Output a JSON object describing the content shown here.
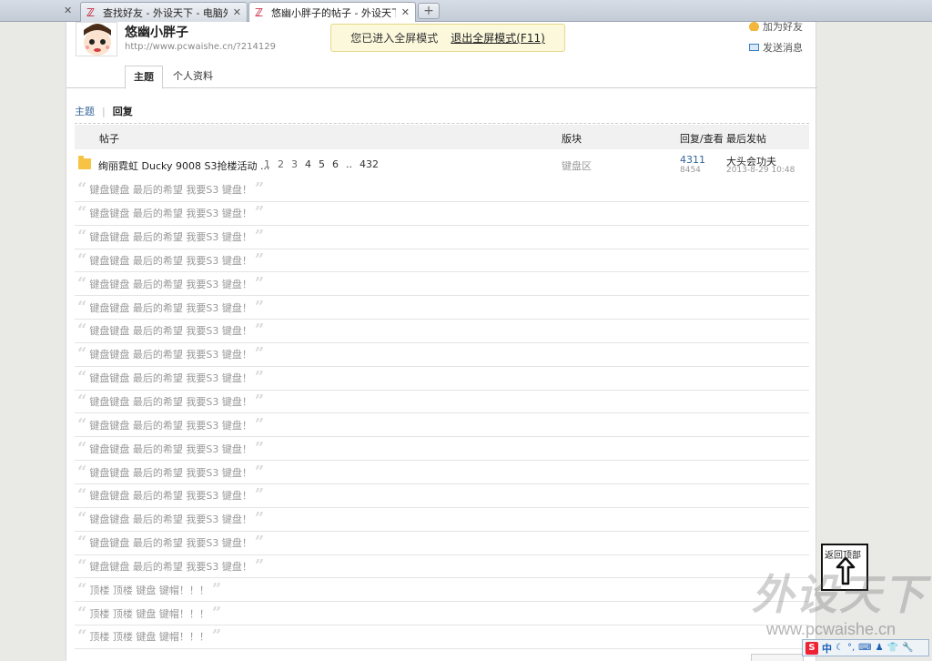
{
  "browser": {
    "tabs": [
      {
        "title": "",
        "active": false
      },
      {
        "title": "查找好友 - 外设天下 - 电脑外",
        "active": false
      },
      {
        "title": "悠幽小胖子的帖子 - 外设天下",
        "active": true
      }
    ],
    "close_glyph": "✕",
    "new_tab_glyph": "+"
  },
  "profile": {
    "username": "悠幽小胖子",
    "url": "http://www.pcwaishe.cn/?214129",
    "add_friend": "加为好友",
    "send_message": "发送消息",
    "tabs": [
      "主题",
      "个人资料"
    ]
  },
  "fullscreen": {
    "notice": "您已进入全屏模式",
    "exit_label": "退出全屏模式(F11)"
  },
  "subnav": {
    "topics": "主题",
    "separator": "|",
    "replies": "回复"
  },
  "table": {
    "headers": {
      "thread": "帖子",
      "board": "版块",
      "stats": "回复/查看",
      "last_post": "最后发帖"
    },
    "thread": {
      "title": "绚丽霓虹 Ducky 9008 S3抢楼活动 ...",
      "pages": [
        "1",
        "2",
        "3",
        "4",
        "5",
        "6",
        "..",
        "432"
      ],
      "board": "键盘区",
      "replies": "4311",
      "views": "8454",
      "last_user": "大头会功夫",
      "last_time": "2013-8-29 10:48"
    },
    "reply_snippets": [
      "键盘键盘 最后的希望 我要S3 键盘！",
      "键盘键盘 最后的希望 我要S3 键盘！",
      "键盘键盘 最后的希望 我要S3 键盘！",
      "键盘键盘 最后的希望 我要S3 键盘！",
      "键盘键盘 最后的希望 我要S3 键盘！",
      "键盘键盘 最后的希望 我要S3 键盘！",
      "键盘键盘 最后的希望 我要S3 键盘！",
      "键盘键盘 最后的希望 我要S3 键盘！",
      "键盘键盘 最后的希望 我要S3 键盘！",
      "键盘键盘 最后的希望 我要S3 键盘！",
      "键盘键盘 最后的希望 我要S3 键盘！",
      "键盘键盘 最后的希望 我要S3 键盘！",
      "键盘键盘 最后的希望 我要S3 键盘！",
      "键盘键盘 最后的希望 我要S3 键盘！",
      "键盘键盘 最后的希望 我要S3 键盘！",
      "键盘键盘 最后的希望 我要S3 键盘！",
      "键盘键盘 最后的希望 我要S3 键盘！",
      "顶楼 顶楼 键盘 键帽！！！",
      "顶楼 顶楼 键盘 键帽！！！",
      "顶楼 顶楼 键盘 键帽！！！"
    ],
    "quote_open": "“",
    "quote_close": "”"
  },
  "back_to_top": {
    "label": "返回顶部"
  },
  "watermark": {
    "logo": "外设天下",
    "url": "www.pcwaishe.cn"
  },
  "ime": {
    "logo": "S",
    "mode": "中",
    "icons": [
      "☾",
      "°,",
      "⌨",
      "♟",
      "👕",
      "🔧"
    ]
  }
}
